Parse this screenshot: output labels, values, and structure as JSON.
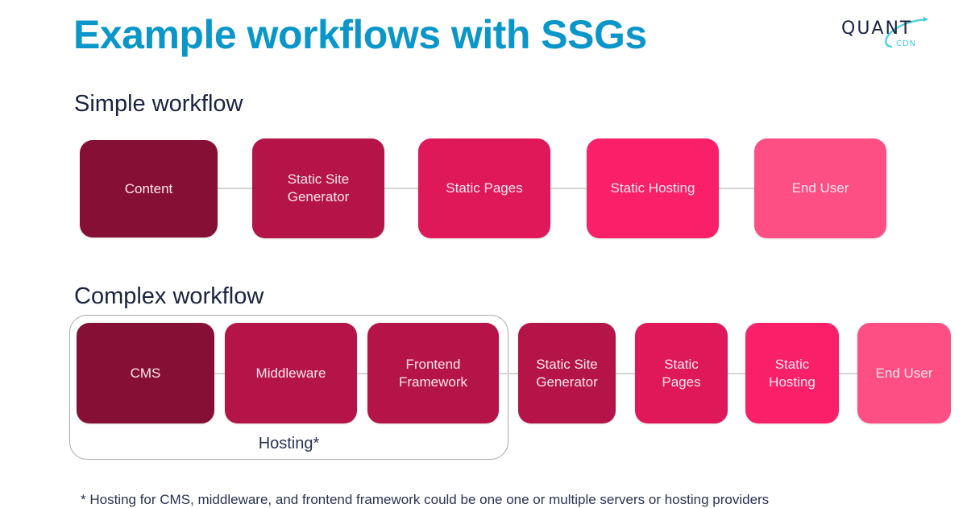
{
  "title": "Example workflows with SSGs",
  "logo": {
    "main": "QUANT",
    "sub": "CDN",
    "colors": {
      "main": "#1b2340",
      "accent": "#3fd0e0"
    }
  },
  "simple": {
    "heading": "Simple workflow",
    "steps": [
      {
        "label": "Content",
        "color": "#860f35"
      },
      {
        "label": "Static Site\nGenerator",
        "color": "#b41447"
      },
      {
        "label": "Static Pages",
        "color": "#df185a"
      },
      {
        "label": "Static Hosting",
        "color": "#f91f68"
      },
      {
        "label": "End User",
        "color": "#fd4f84"
      }
    ]
  },
  "complex": {
    "heading": "Complex workflow",
    "hosting_group_label": "Hosting*",
    "steps": [
      {
        "label": "CMS",
        "color": "#860f35"
      },
      {
        "label": "Middleware",
        "color": "#b41447"
      },
      {
        "label": "Frontend\nFramework",
        "color": "#b41447"
      },
      {
        "label": "Static Site\nGenerator",
        "color": "#b41447"
      },
      {
        "label": "Static\nPages",
        "color": "#df185a"
      },
      {
        "label": "Static\nHosting",
        "color": "#f91f68"
      },
      {
        "label": "End User",
        "color": "#fd4f84"
      }
    ]
  },
  "footnote": "* Hosting for CMS, middleware, and frontend framework could be one one or multiple servers or hosting providers"
}
